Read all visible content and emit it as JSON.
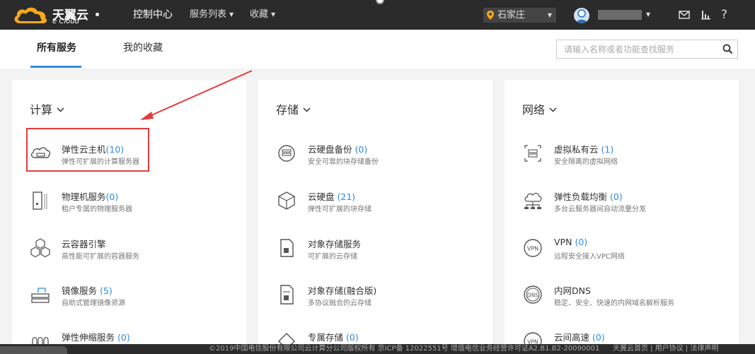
{
  "header": {
    "logo_cn": "天翼云",
    "logo_en": "e Cloud",
    "nav": [
      {
        "label": "控制中心"
      },
      {
        "label": "服务列表"
      },
      {
        "label": "收藏"
      }
    ],
    "region": "石家庄"
  },
  "tabs": [
    {
      "label": "所有服务",
      "active": true
    },
    {
      "label": "我的收藏",
      "active": false
    }
  ],
  "search": {
    "placeholder": "请输入名称或者功能查找服务"
  },
  "categories": [
    {
      "title": "计算",
      "services": [
        {
          "name": "弹性云主机",
          "count": "(10)",
          "desc": "弹性可扩展的计算服务器",
          "icon": "cloud-server-icon",
          "highlighted": true
        },
        {
          "name": "物理机服务",
          "count": "(0)",
          "desc": "租户专属的物理服务器",
          "icon": "physical-server-icon"
        },
        {
          "name": "云容器引擎",
          "count": "",
          "desc": "高性能可扩展的容器服务",
          "icon": "container-icon"
        },
        {
          "name": "镜像服务",
          "count": "(5)",
          "desc": "自助式管理镜像资源",
          "icon": "image-service-icon"
        },
        {
          "name": "弹性伸缩服务",
          "count": "(0)",
          "desc": "",
          "icon": "auto-scaling-icon"
        }
      ]
    },
    {
      "title": "存储",
      "services": [
        {
          "name": "云硬盘备份",
          "count": "(0)",
          "desc": "安全可靠的块存储备份",
          "icon": "disk-backup-icon"
        },
        {
          "name": "云硬盘",
          "count": "(21)",
          "desc": "弹性可扩展的块存储",
          "icon": "cloud-disk-icon"
        },
        {
          "name": "对象存储服务",
          "count": "",
          "desc": "可扩展的云存储",
          "icon": "object-storage-icon"
        },
        {
          "name": "对象存储(融合版)",
          "count": "",
          "desc": "多协议融合的云存储",
          "icon": "object-storage-fusion-icon"
        },
        {
          "name": "专属存储",
          "count": "(0)",
          "desc": "",
          "icon": "dedicated-storage-icon"
        }
      ]
    },
    {
      "title": "网络",
      "services": [
        {
          "name": "虚拟私有云",
          "count": "(1)",
          "desc": "安全隔离的虚拟网络",
          "icon": "vpc-icon"
        },
        {
          "name": "弹性负载均衡",
          "count": "(0)",
          "desc": "多台云服务器间自动流量分发",
          "icon": "load-balancer-icon"
        },
        {
          "name": "VPN",
          "count": "(0)",
          "desc": "远程安全接入VPC网络",
          "icon": "vpn-icon"
        },
        {
          "name": "内网DNS",
          "count": "",
          "desc": "稳定、安全、快速的内网域名解析服务",
          "icon": "dns-icon"
        },
        {
          "name": "云间高速",
          "count": "(0)",
          "desc": "",
          "icon": "cloud-express-icon"
        }
      ]
    }
  ],
  "footer": {
    "copyright": "©2019中国电信股份有限公司云计算分公司版权所有  京ICP备 12022551号  增值电信业务经营许可证A2.B1.B2-20090001",
    "links": "天翼云首页  |  用户协议  |  法律声明"
  }
}
